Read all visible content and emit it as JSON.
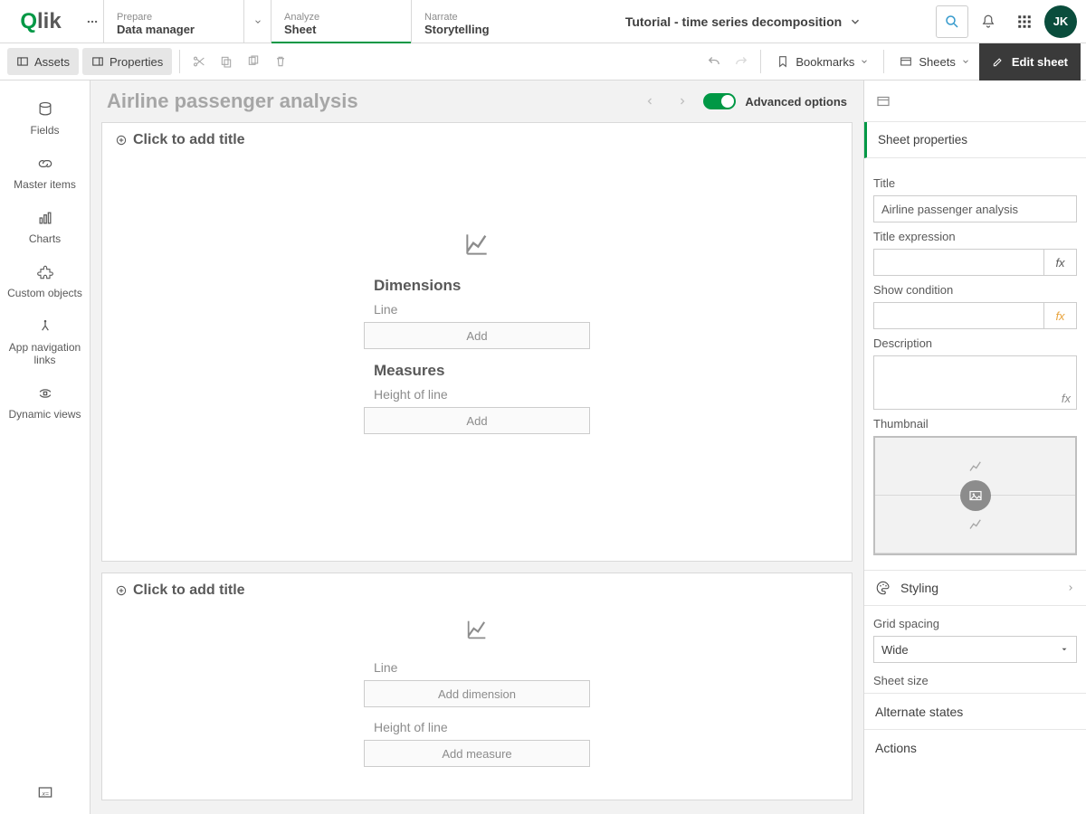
{
  "header": {
    "logo_text": "Qlik",
    "tabs": [
      {
        "section": "Prepare",
        "value": "Data manager"
      },
      {
        "section": "Analyze",
        "value": "Sheet"
      },
      {
        "section": "Narrate",
        "value": "Storytelling"
      }
    ],
    "app_title": "Tutorial - time series decomposition",
    "avatar_initials": "JK"
  },
  "toolbar": {
    "assets_label": "Assets",
    "properties_label": "Properties",
    "bookmarks_label": "Bookmarks",
    "sheets_label": "Sheets",
    "edit_sheet_label": "Edit sheet"
  },
  "left_panel": {
    "items": [
      "Fields",
      "Master items",
      "Charts",
      "Custom objects",
      "App navigation links",
      "Dynamic views"
    ]
  },
  "canvas": {
    "sheet_title": "Airline passenger analysis",
    "advanced_options_label": "Advanced options",
    "add_title_placeholder": "Click to add title",
    "viz1": {
      "dimensions_heading": "Dimensions",
      "dimensions_field": "Line",
      "dimensions_add": "Add",
      "measures_heading": "Measures",
      "measures_field": "Height of line",
      "measures_add": "Add"
    },
    "viz2": {
      "dim_field": "Line",
      "dim_add": "Add dimension",
      "meas_field": "Height of line",
      "meas_add": "Add measure"
    }
  },
  "props": {
    "section_title": "Sheet properties",
    "title_label": "Title",
    "title_value": "Airline passenger analysis",
    "title_expr_label": "Title expression",
    "show_cond_label": "Show condition",
    "description_label": "Description",
    "thumbnail_label": "Thumbnail",
    "styling_label": "Styling",
    "grid_spacing_label": "Grid spacing",
    "grid_spacing_value": "Wide",
    "sheet_size_label": "Sheet size",
    "alternate_states_label": "Alternate states",
    "actions_label": "Actions"
  }
}
